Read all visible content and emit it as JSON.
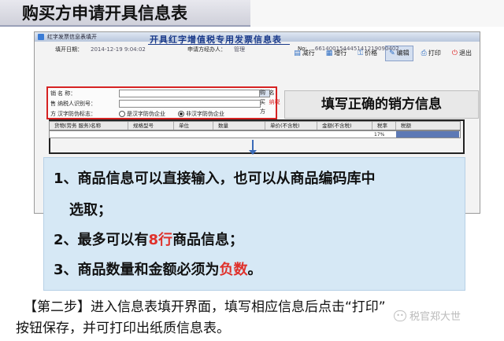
{
  "slide_title": "购买方申请开具信息表",
  "window": {
    "title": "红字发票信息表填开",
    "toolbar": [
      {
        "label": "减行",
        "icon": "minus-row-icon"
      },
      {
        "label": "增行",
        "icon": "plus-row-icon"
      },
      {
        "label": "价格",
        "icon": "price-icon"
      },
      {
        "label": "编辑",
        "icon": "edit-icon"
      },
      {
        "label": "打印",
        "icon": "print-icon"
      },
      {
        "label": "退出",
        "icon": "exit-icon"
      }
    ],
    "form_title": "开具红字增值税专用发票信息表",
    "fill_date_label": "填开日期：",
    "fill_date_value": "2014-12-19 9:04:02",
    "handler_label": "申请方经办人：",
    "handler_value": "管理",
    "no_label": "No:",
    "no_value": "661400154445141219090402",
    "seller": {
      "side_labels": [
        "销",
        "售",
        "方"
      ],
      "name_label": "名        称：",
      "taxid_label": "纳税人识别号：",
      "flag_label": "汉字防伪标志：",
      "radio_yes": "是汉字防伪企业",
      "radio_no": "非汉字防伪企业"
    },
    "buyer_side": {
      "labels": [
        "购",
        "买",
        "方"
      ],
      "name_short": "名",
      "taxid_short": "纳税"
    },
    "goods_columns": [
      "货物(劳务 服务)名称",
      "规格型号",
      "单位",
      "数量",
      "单价(不含税)",
      "金额(不含税)",
      "税率",
      "税额"
    ],
    "goods_row_tax": "17%"
  },
  "callout": "填写正确的销方信息",
  "info_lines": {
    "l1a": "1、商品信息可以直接输入，也可以从商品编码库中",
    "l1b": "选取；",
    "l2_pre": "2、最多可以有",
    "l2_red": "8行",
    "l2_post": "商品信息；",
    "l3_pre": "3、商品数量和金额必须为",
    "l3_red": "负数",
    "l3_post": "。"
  },
  "footer": {
    "line1": "【第二步】进入信息表填开界面，填写相应信息后点击“打印”",
    "line2": "按钮保存，并可打印出纸质信息表。"
  },
  "watermark": "税官郑大世",
  "colors": {
    "accent_red": "#e0312b",
    "info_bg": "#d6e8f5",
    "title_blue": "#1a3a8a"
  }
}
